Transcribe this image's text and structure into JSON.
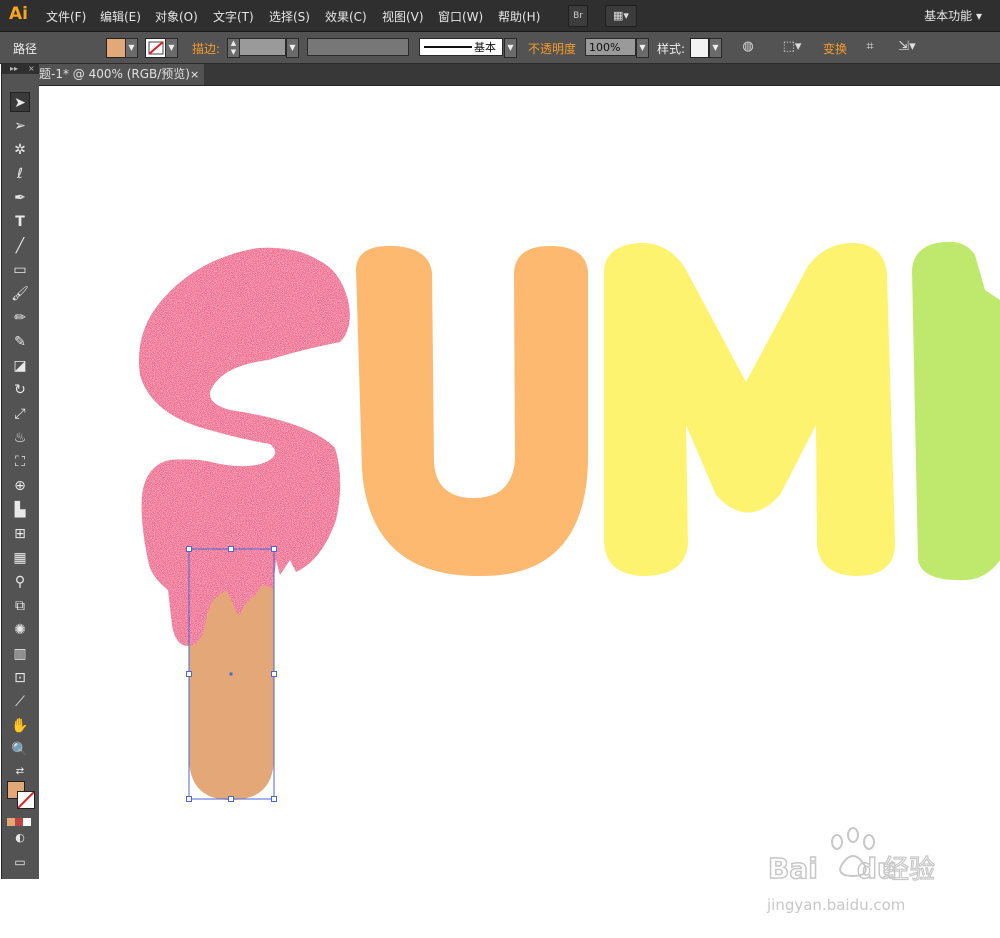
{
  "app": {
    "logo": "Ai",
    "workspace": "基本功能 ▾"
  },
  "menus": [
    "文件(F)",
    "编辑(E)",
    "对象(O)",
    "文字(T)",
    "选择(S)",
    "效果(C)",
    "视图(V)",
    "窗口(W)",
    "帮助(H)"
  ],
  "menu_buttons": {
    "bridge": "Br",
    "arrange": "▦▾"
  },
  "control": {
    "object_type": "路径",
    "stroke_label": "描边:",
    "brush_style": "基本",
    "opacity_label": "不透明度",
    "opacity_value": "100%",
    "style_label": "样式:",
    "transform_label": "变换",
    "fill_color": "#e4a878"
  },
  "document": {
    "tab_title": "题-1* @ 400% (RGB/预览)",
    "close": "×"
  },
  "toolbox": {
    "collapse": "▸▸",
    "close": "×"
  },
  "artwork": {
    "letters": [
      {
        "char": "S",
        "color": "#ef5b88"
      },
      {
        "char": "U",
        "color": "#fdb96f"
      },
      {
        "char": "M",
        "color": "#fdf36e"
      },
      {
        "char": "M",
        "color": "#bfe96c"
      }
    ],
    "stick_color": "#e4a878"
  },
  "watermark": {
    "brand": "Bai",
    "brand2": "du",
    "cn": "经验",
    "url": "jingyan.baidu.com"
  }
}
